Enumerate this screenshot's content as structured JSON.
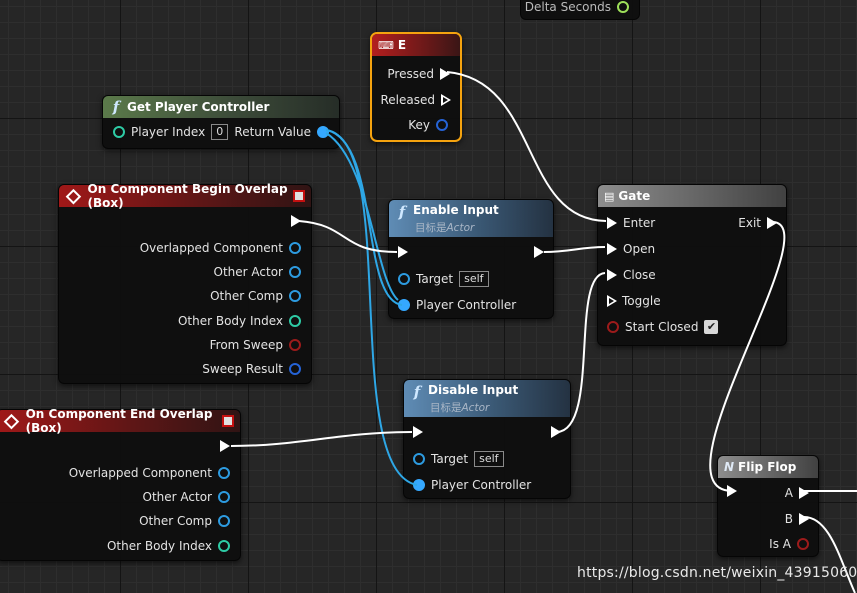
{
  "top_fragment": {
    "pin_label": "Delta Seconds"
  },
  "key_e_node": {
    "title": "E",
    "pressed": "Pressed",
    "released": "Released",
    "key": "Key"
  },
  "get_player_controller": {
    "title": "Get Player Controller",
    "player_index_label": "Player Index",
    "player_index_value": "0",
    "return_value": "Return Value"
  },
  "begin_overlap": {
    "title": "On Component Begin Overlap (Box)",
    "outputs": [
      "Overlapped Component",
      "Other Actor",
      "Other Comp",
      "Other Body Index",
      "From Sweep",
      "Sweep Result"
    ]
  },
  "end_overlap": {
    "title": "On Component End Overlap (Box)",
    "outputs": [
      "Overlapped Component",
      "Other Actor",
      "Other Comp",
      "Other Body Index"
    ]
  },
  "enable_input": {
    "title": "Enable Input",
    "subtitle_prefix": "目标是",
    "subtitle_class": "Actor",
    "target_label": "Target",
    "target_value": "self",
    "player_controller": "Player Controller"
  },
  "disable_input": {
    "title": "Disable Input",
    "subtitle_prefix": "目标是",
    "subtitle_class": "Actor",
    "target_label": "Target",
    "target_value": "self",
    "player_controller": "Player Controller"
  },
  "gate": {
    "title": "Gate",
    "enter": "Enter",
    "open": "Open",
    "close": "Close",
    "toggle": "Toggle",
    "start_closed": "Start Closed",
    "exit": "Exit"
  },
  "flip_flop": {
    "title": "Flip Flop",
    "a": "A",
    "b": "B",
    "is_a": "Is A"
  },
  "watermark": "https://blog.csdn.net/weixin_43915060",
  "colors": {
    "exec_wire": "#ffffff",
    "object_wire": "#2ea7e6",
    "key_node_outline": "#f5a30f"
  }
}
